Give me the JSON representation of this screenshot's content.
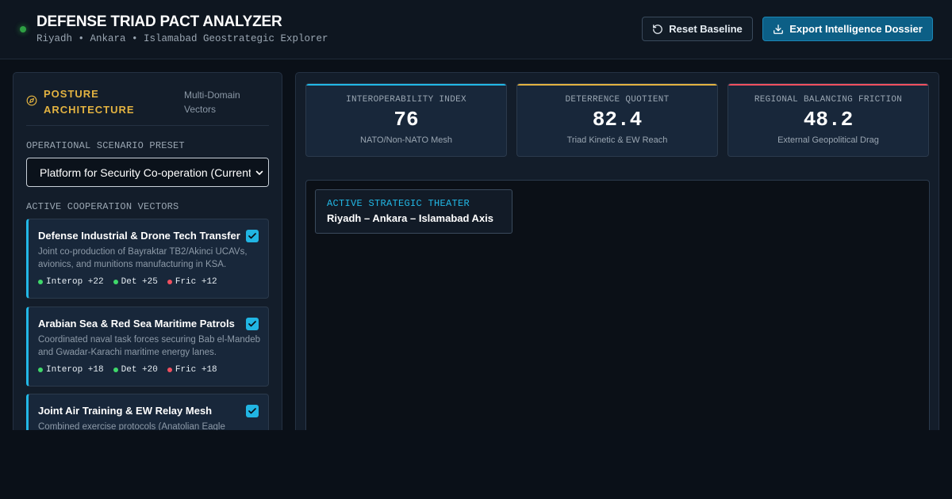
{
  "header": {
    "title": "DEFENSE TRIAD PACT ANALYZER",
    "subtitle": "Riyadh • Ankara • Islamabad Geostrategic Explorer",
    "reset_label": "Reset Baseline",
    "export_label": "Export Intelligence Dossier",
    "status_color": "#2ea043",
    "reset_icon": "rotate-ccw-icon",
    "export_icon": "download-icon"
  },
  "sidebar": {
    "title": "POSTURE ARCHITECTURE",
    "tag": "Multi-Domain Vectors",
    "title_icon": "compass-icon",
    "scenario_label": "OPERATIONAL SCENARIO PRESET",
    "scenario_value": "Platform for Security Co-operation (Current)",
    "vectors_label": "ACTIVE COOPERATION VECTORS",
    "vectors": [
      {
        "title": "Defense Industrial & Drone Tech Transfer",
        "description": "Joint co-production of Bayraktar TB2/Akinci UCAVs, avionics, and munitions manufacturing in KSA.",
        "checked": true,
        "metrics": [
          "Interop +22",
          "Det +25",
          "Fric +12"
        ]
      },
      {
        "title": "Arabian Sea & Red Sea Maritime Patrols",
        "description": "Coordinated naval task forces securing Bab el-Mandeb and Gwadar-Karachi maritime energy lanes.",
        "checked": true,
        "metrics": [
          "Interop +18",
          "Det +20",
          "Fric +18"
        ]
      },
      {
        "title": "Joint Air Training & EW Relay Mesh",
        "description": "Combined exercise protocols (Anatolian Eagle",
        "checked": true,
        "metrics": []
      }
    ]
  },
  "kpis": [
    {
      "label": "INTEROPERABILITY INDEX",
      "value": "76",
      "sub": "NATO/Non-NATO Mesh",
      "accent": "#22b8e6"
    },
    {
      "label": "DETERRENCE QUOTIENT",
      "value": "82.4",
      "sub": "Triad Kinetic & EW Reach",
      "accent": "#e3b341"
    },
    {
      "label": "REGIONAL BALANCING FRICTION",
      "value": "48.2",
      "sub": "External Geopolitical Drag",
      "accent": "#f0505f"
    }
  ],
  "theater": {
    "label": "ACTIVE STRATEGIC THEATER",
    "name": "Riyadh – Ankara – Islamabad Axis"
  },
  "colors": {
    "accent_cyan": "#22b8e6",
    "accent_gold": "#e3b341",
    "accent_red": "#f0505f",
    "positive_green": "#3fd86a"
  }
}
